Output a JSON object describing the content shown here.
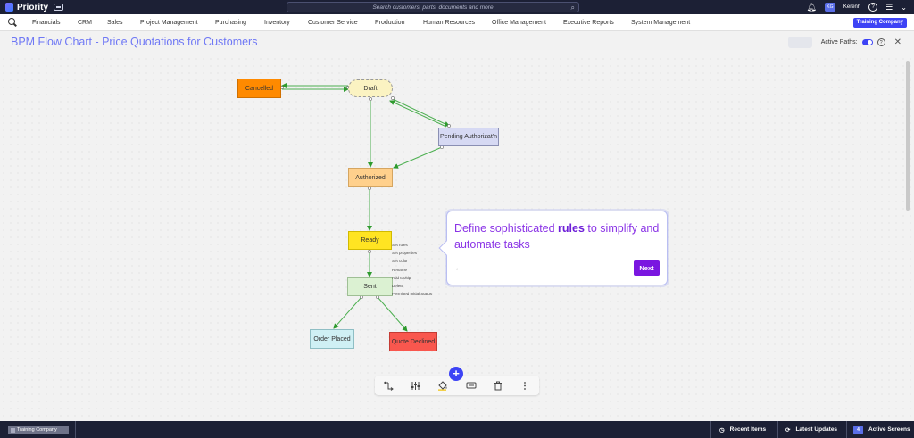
{
  "app": {
    "name": "Priority",
    "search_placeholder": "Search customers, parts, documents and more",
    "user_initials": "KG",
    "user_name": "Kerenh"
  },
  "menu": {
    "items": [
      "Financials",
      "CRM",
      "Sales",
      "Project Management",
      "Purchasing",
      "Inventory",
      "Customer Service",
      "Production",
      "Human Resources",
      "Office Management",
      "Executive Reports",
      "System Management"
    ],
    "company_button": "Training Company"
  },
  "page": {
    "title": "BPM Flow Chart - Price Quotations for Customers",
    "active_paths_label": "Active Paths:",
    "active_paths_on": true
  },
  "nodes": {
    "cancelled": "Cancelled",
    "draft": "Draft",
    "pending": "Pending Authorizat'n",
    "authorized": "Authorized",
    "ready": "Ready",
    "sent": "Sent",
    "order_placed": "Order Placed",
    "quote_declined": "Quote Declined"
  },
  "context_menu": {
    "items": [
      "Set rules",
      "Set properties",
      "Set color",
      "Rename",
      "Add tooltip",
      "Delete",
      "Permitted Initial Status"
    ]
  },
  "tour": {
    "text_before": "Define sophisticated ",
    "text_bold": "rules",
    "text_after": " to simplify and automate tasks",
    "back_symbol": "←",
    "next_label": "Next"
  },
  "toolbar": {
    "icons": [
      "connect-icon",
      "sliders-icon",
      "paint-bucket-icon",
      "tooltip-icon",
      "trash-icon",
      "more-icon"
    ],
    "add_symbol": "+"
  },
  "bottombar": {
    "company": "Training Company",
    "recent_items": "Recent Items",
    "latest_updates": "Latest Updates",
    "active_screens": "Active Screens",
    "active_screens_count": "4"
  },
  "colors": {
    "accent": "#3d43f5",
    "topbar": "#1c2035",
    "tour_next": "#7a16e0",
    "cancelled": "#ff8a00",
    "ready": "#ffe422",
    "declined": "#f9574e"
  }
}
